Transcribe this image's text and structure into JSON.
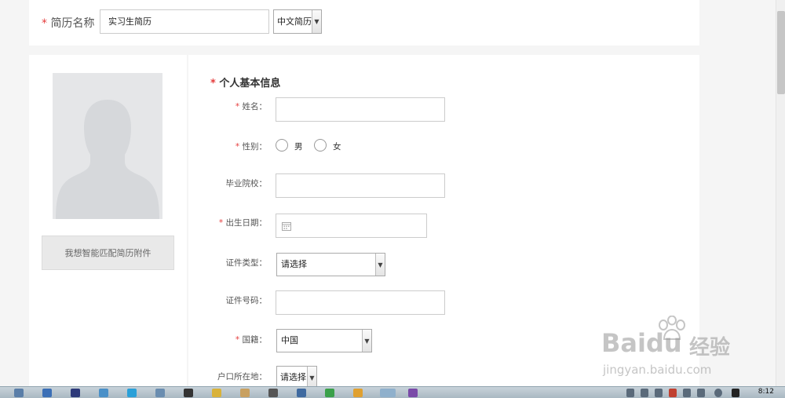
{
  "resume_name": {
    "required_mark": "*",
    "label": "简历名称",
    "value": "实习生简历",
    "language_select": "中文简历"
  },
  "photo_panel": {
    "match_button_label": "我想智能匹配简历附件"
  },
  "basic_info": {
    "required_mark": "*",
    "title": "个人基本信息",
    "fields": {
      "name_label": "姓名：",
      "gender_label": "性别：",
      "gender_male": "男",
      "gender_female": "女",
      "school_label": "毕业院校：",
      "birth_label": "出生日期：",
      "id_type_label": "证件类型：",
      "id_type_value": "请选择",
      "id_number_label": "证件号码：",
      "nationality_label": "国籍：",
      "nationality_value": "中国",
      "hukou_label": "户口所在地：",
      "hukou_value": "请选择"
    }
  },
  "watermark": {
    "brand": "Bai",
    "brand_suffix": "du",
    "product": "经验",
    "url": "jingyan.baidu.com"
  },
  "taskbar": {
    "time": "8:12"
  },
  "colors": {
    "required": "#e53c3c",
    "border": "#cccccc",
    "background": "#f5f5f5"
  }
}
